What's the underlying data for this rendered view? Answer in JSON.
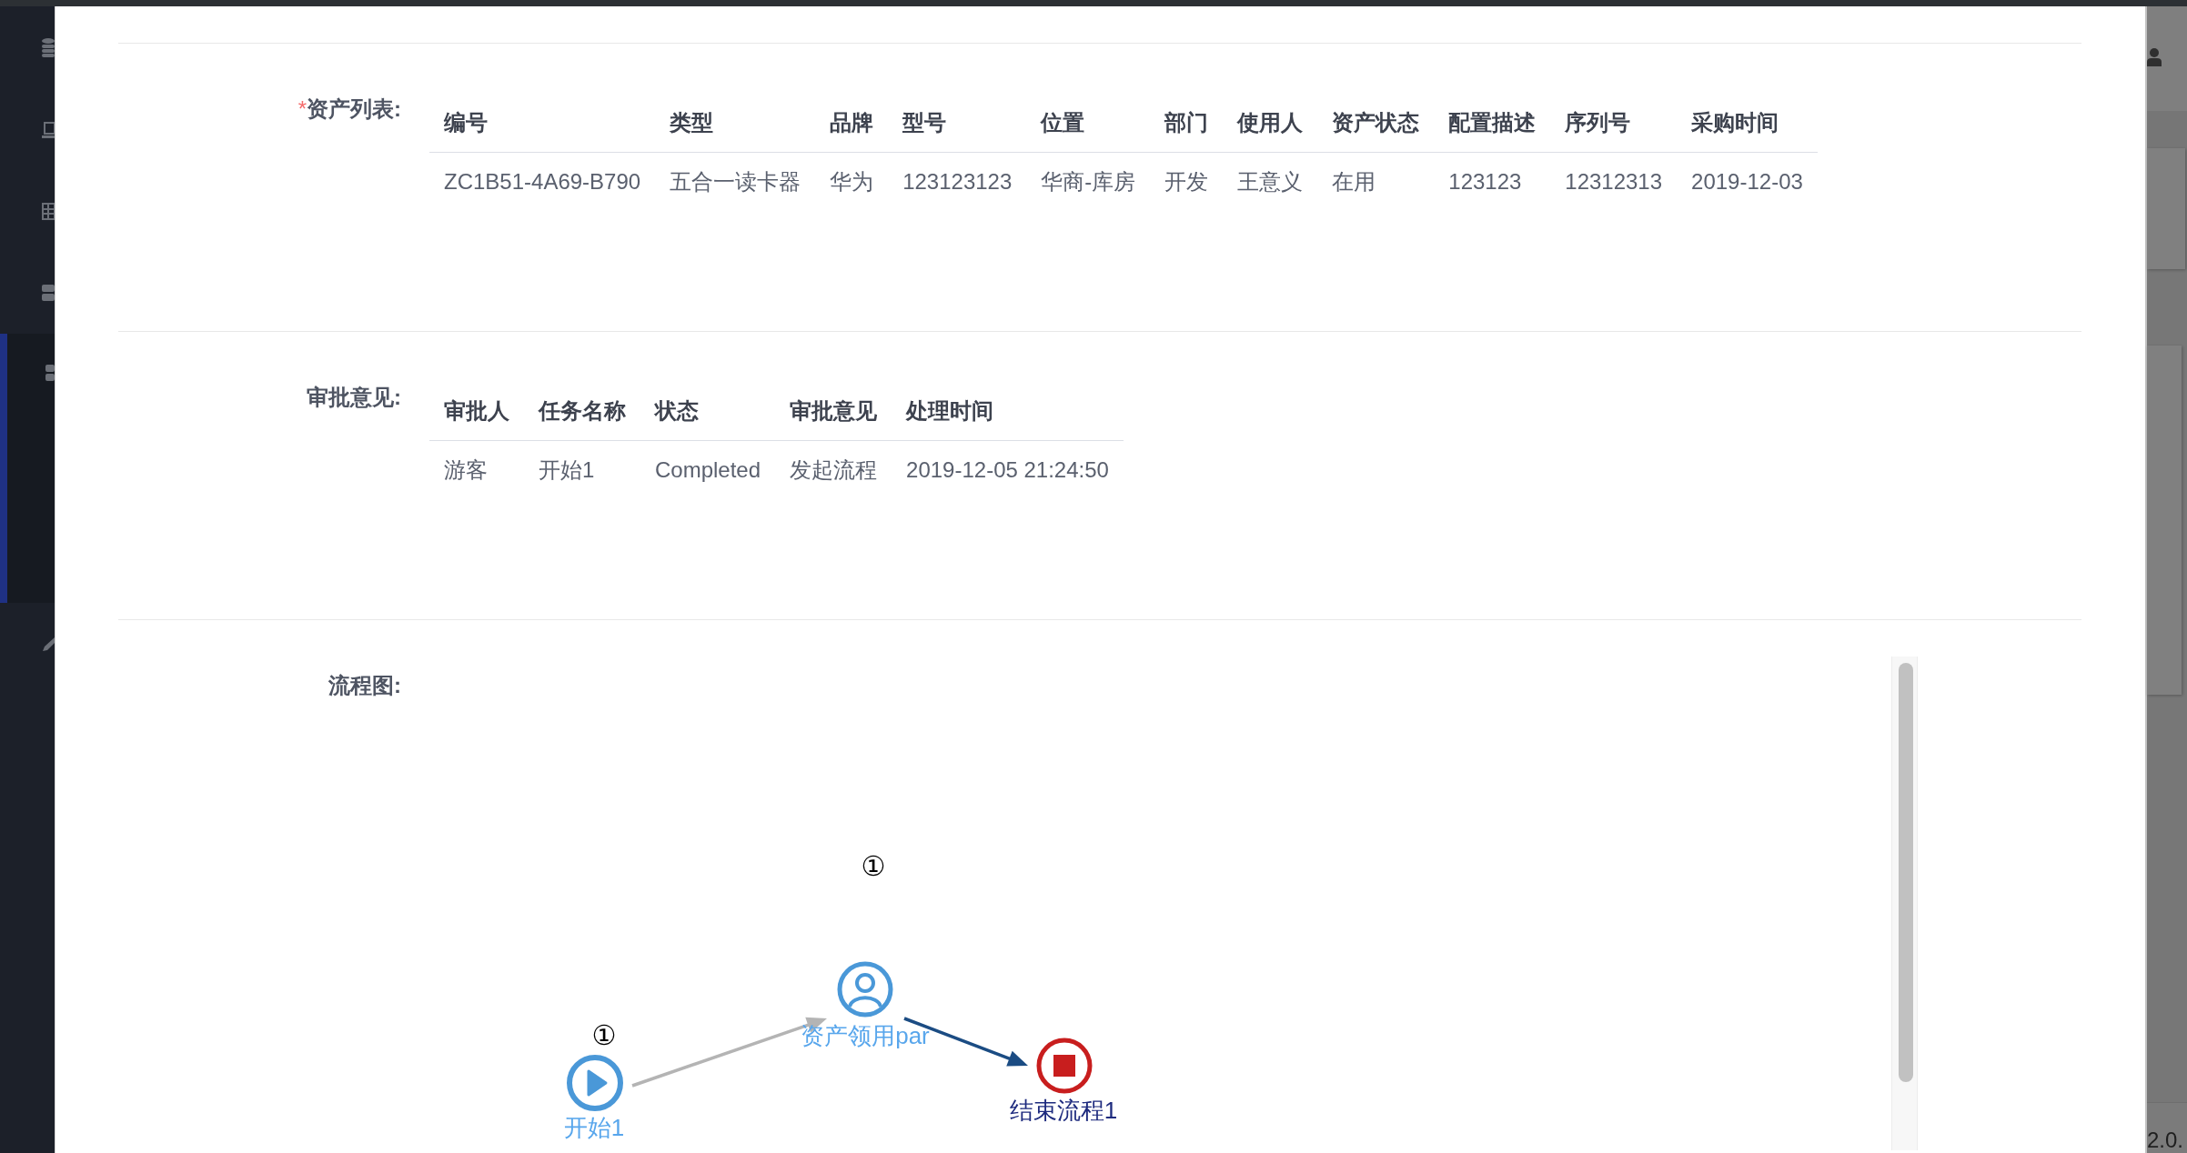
{
  "sidebar": {
    "items": [
      {
        "selected": false
      },
      {
        "selected": false
      },
      {
        "selected": false
      },
      {
        "selected": false
      },
      {
        "selected": true
      },
      {
        "selected": false
      }
    ]
  },
  "dialog": {
    "sections": [
      {
        "kind": "table",
        "required_mark": "*",
        "label": "资产列表:",
        "table": {
          "columns": [
            "编号",
            "类型",
            "品牌",
            "型号",
            "位置",
            "部门",
            "使用人",
            "资产状态",
            "配置描述",
            "序列号",
            "采购时间"
          ],
          "rows": [
            [
              "ZC1B51-4A69-B790",
              "五合一读卡器",
              "华为",
              "123123123",
              "华商-库房",
              "开发",
              "王意义",
              "在用",
              "123123",
              "12312313",
              "2019-12-03"
            ]
          ]
        }
      },
      {
        "kind": "table",
        "label": "审批意见:",
        "table": {
          "columns": [
            "审批人",
            "任务名称",
            "状态",
            "审批意见",
            "处理时间"
          ],
          "rows": [
            [
              "游客",
              "开始1",
              "Completed",
              "发起流程",
              "2019-12-05 21:24:50"
            ]
          ]
        }
      },
      {
        "kind": "diagram",
        "label": "流程图:",
        "diagram": {
          "nodes": [
            {
              "kind": "start",
              "label": "开始1",
              "badge": "①",
              "outgoing": {
                "color": "#b4b4b4"
              }
            },
            {
              "kind": "user_task",
              "label": "资产领用par",
              "badge": "①",
              "outgoing": {
                "color": "#1b4c83"
              }
            },
            {
              "kind": "end",
              "label": "结束流程1"
            }
          ]
        }
      }
    ]
  },
  "background_page": {
    "version": "2.0."
  }
}
